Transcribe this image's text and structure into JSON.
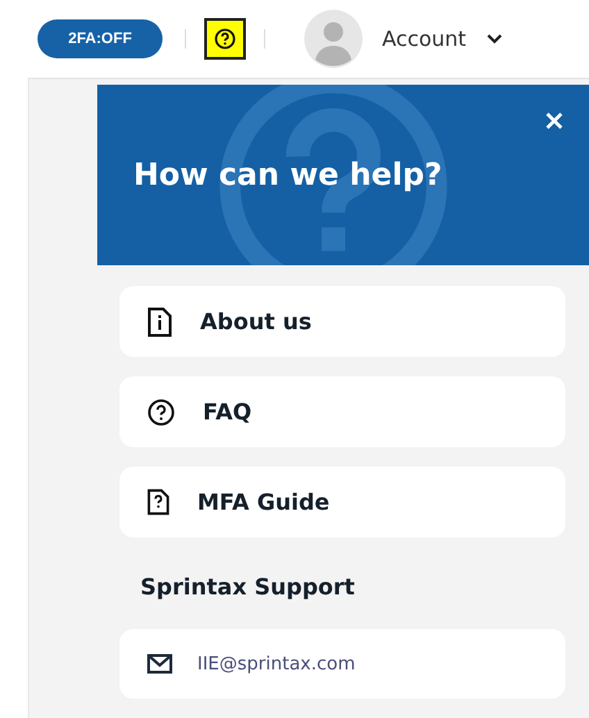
{
  "header": {
    "twofa_badge": "2FA:OFF",
    "help_highlighted": true,
    "account_label": "Account"
  },
  "help_panel": {
    "title": "How can we help?",
    "items": [
      {
        "kind": "info-doc",
        "label": "About us"
      },
      {
        "kind": "question-circle",
        "label": "FAQ"
      },
      {
        "kind": "question-doc",
        "label": "MFA Guide"
      }
    ],
    "support_heading": "Sprintax Support",
    "contacts": [
      {
        "kind": "email",
        "label": "IIE@sprintax.com"
      }
    ]
  }
}
